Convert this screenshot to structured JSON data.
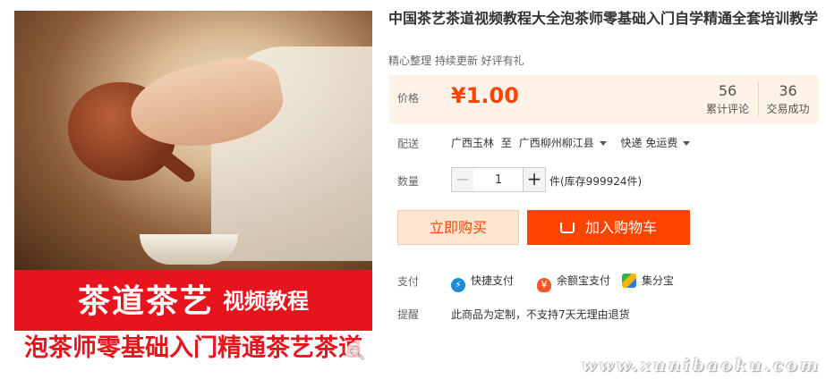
{
  "product": {
    "title": "中国茶艺茶道视频教程大全泡茶师零基础入门自学精通全套培训教学",
    "subtitle": "精心整理 持续更新 好评有礼",
    "image_banner": {
      "line1_big": "茶道茶艺",
      "line1_small": "视频教程",
      "line2": "泡茶师零基础入门精通茶艺茶道"
    }
  },
  "price": {
    "label": "价格",
    "value": "¥1.00",
    "reviews_count": "56",
    "reviews_label": "累计评论",
    "sales_count": "36",
    "sales_label": "交易成功"
  },
  "shipping": {
    "label": "配送",
    "from": "广西玉林",
    "to_word": "至",
    "destination": "广西柳州柳江县",
    "method": "快递 免运费"
  },
  "quantity": {
    "label": "数量",
    "minus": "−",
    "value": "1",
    "plus": "+",
    "stock": "件(库存999924件)"
  },
  "actions": {
    "buy_now": "立即购买",
    "add_to_cart": "加入购物车"
  },
  "payment": {
    "label": "支付",
    "methods": [
      {
        "name": "快捷支付",
        "icon": "quick-pay-icon"
      },
      {
        "name": "余额宝支付",
        "icon": "yuebao-icon"
      },
      {
        "name": "集分宝",
        "icon": "jifenbao-icon"
      }
    ]
  },
  "reminder": {
    "label": "提醒",
    "text": "此商品为定制，不支持7天无理由退货"
  },
  "watermark": "www.xunibaoku.com",
  "colors": {
    "accent": "#ff4400",
    "price_bg": "#fff2e8",
    "banner_red": "#e7141d"
  }
}
